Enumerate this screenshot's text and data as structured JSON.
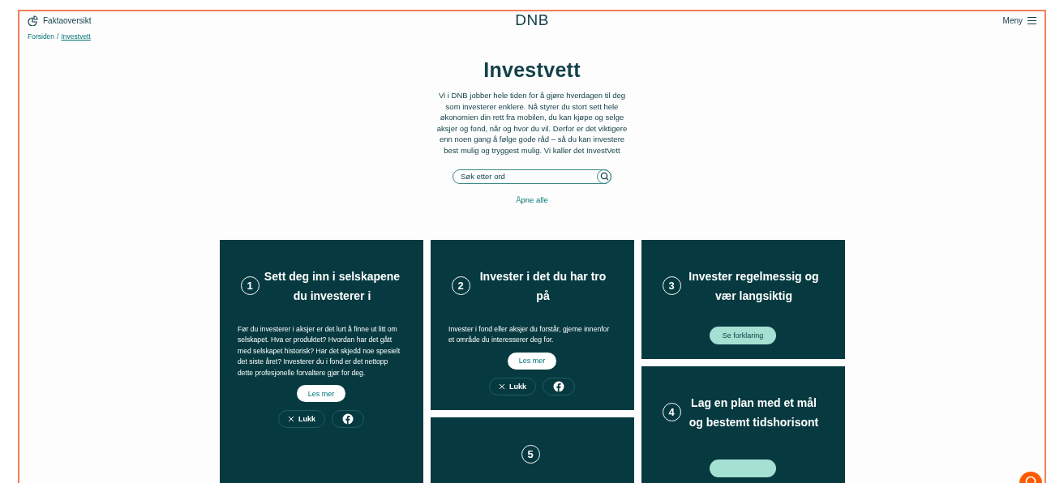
{
  "header": {
    "facts_link": "Faktaoversikt",
    "logo": "DNB",
    "menu": "Meny"
  },
  "breadcrumb": {
    "separator": "/",
    "items": [
      {
        "label": "Forsiden",
        "current": false
      },
      {
        "label": "Investvett",
        "current": true
      }
    ]
  },
  "title": "Investvett",
  "intro": "Vi i DNB jobber hele tiden for å gjøre hverdagen til deg som investerer enklere. Nå styrer du stort sett hele økonomien din rett fra mobilen, du kan kjøpe og selge aksjer og fond, når og hvor du vil. Derfor er det viktigere enn noen gang å følge gode råd – så du kan investere best mulig og tryggest mulig. Vi kaller det InvestVett",
  "search": {
    "placeholder": "Søk etter ord"
  },
  "open_all": "Åpne alle",
  "columns": [
    [
      {
        "number": "1",
        "title": "Sett deg inn i selskapene du investerer i",
        "expanded": true,
        "text": "Før du investerer i aksjer er det lurt å finne ut litt om selskapet. Hva er produktet? Hvordan har det gått med selskapet historisk? Har det skjedd noe spesielt det siste året? Investerer du i fond er det nettopp dette profesjonelle forvaltere gjør for deg.",
        "read_more": "Les mer",
        "close": "Lukk"
      }
    ],
    [
      {
        "number": "2",
        "title": "Invester i det du har tro på",
        "expanded": true,
        "text": "Invester i fond eller aksjer du forstår, gjerne innenfor et område du interesserer deg for.",
        "read_more": "Les mer",
        "close": "Lukk"
      },
      {
        "number": "5",
        "expanded": false
      }
    ],
    [
      {
        "number": "3",
        "title": "Invester regelmessig og vær langsiktig",
        "expanded": false,
        "explain": "Se forklaring"
      },
      {
        "number": "4",
        "title": "Lag en plan med et mål og bestemt tidshorisont",
        "expanded": false,
        "explain_cut": true
      }
    ]
  ]
}
